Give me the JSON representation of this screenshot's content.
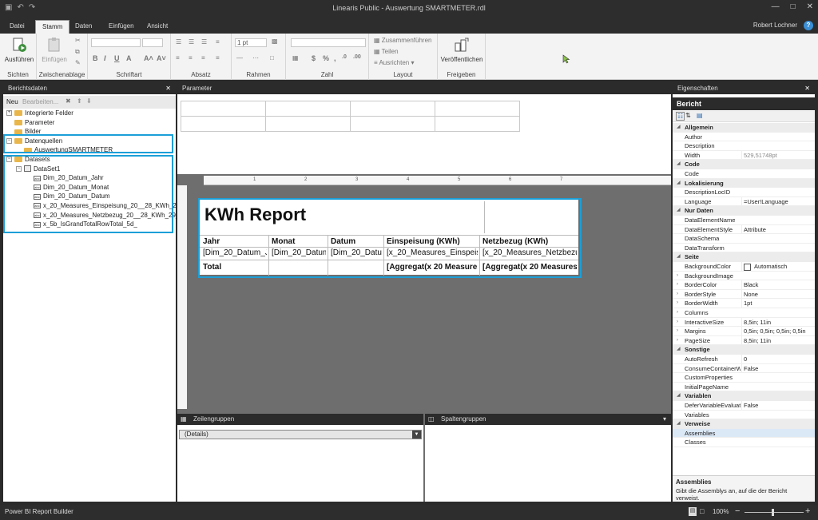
{
  "window": {
    "title": "Linearis Public - Auswertung SMARTMETER.rdl",
    "user": "Robert Lochner",
    "help": "?"
  },
  "tabs": [
    "Datei",
    "Stamm",
    "Daten",
    "Einfügen",
    "Ansicht"
  ],
  "ribbon": {
    "run": "Ausführen",
    "paste": "Einfügen",
    "groups": [
      "Sichten",
      "Zwischenablage",
      "Schriftart",
      "Absatz",
      "Rahmen",
      "Zahl",
      "Layout",
      "Freigeben"
    ],
    "border_width": "1 pt",
    "merge": "Zusammenführen",
    "split": "Teilen",
    "align": "Ausrichten",
    "publish": "Veröffentlichen",
    "font_btns": [
      "B",
      "I",
      "U",
      "A",
      "A˄",
      "A˅"
    ],
    "num_btns": [
      "$",
      "%",
      ",",
      ".0",
      ".00"
    ]
  },
  "left": {
    "header": "Berichtsdaten",
    "new": "Neu",
    "edit": "Bearbeiten...",
    "tree": [
      {
        "label": "Integrierte Felder",
        "indent": 0,
        "type": "folder",
        "exp": "+"
      },
      {
        "label": "Parameter",
        "indent": 0,
        "type": "folder",
        "exp": ""
      },
      {
        "label": "Bilder",
        "indent": 0,
        "type": "folder",
        "exp": ""
      },
      {
        "label": "Datenquellen",
        "indent": 0,
        "type": "folder",
        "exp": "−"
      },
      {
        "label": "AuswertungSMARTMETER",
        "indent": 1,
        "type": "folder",
        "exp": ""
      },
      {
        "label": "Datasets",
        "indent": 0,
        "type": "folder",
        "exp": "−"
      },
      {
        "label": "DataSet1",
        "indent": 1,
        "type": "dataset",
        "exp": "−"
      },
      {
        "label": "Dim_20_Datum_Jahr",
        "indent": 2,
        "type": "field",
        "exp": ""
      },
      {
        "label": "Dim_20_Datum_Monat",
        "indent": 2,
        "type": "field",
        "exp": ""
      },
      {
        "label": "Dim_20_Datum_Datum",
        "indent": 2,
        "type": "field",
        "exp": ""
      },
      {
        "label": "x_20_Measures_Einspeisung_20__28_KWh_29_",
        "indent": 2,
        "type": "field",
        "exp": ""
      },
      {
        "label": "x_20_Measures_Netzbezug_20__28_KWh_29_",
        "indent": 2,
        "type": "field",
        "exp": ""
      },
      {
        "label": "x_5b_IsGrandTotalRowTotal_5d_",
        "indent": 2,
        "type": "field",
        "exp": ""
      }
    ],
    "field_icon": "abc"
  },
  "center": {
    "param_header": "Parameter",
    "ruler": [
      "1",
      "2",
      "3",
      "4",
      "5",
      "6",
      "7"
    ],
    "report": {
      "title": "KWh Report",
      "headers": [
        "Jahr",
        "Monat",
        "Datum",
        "Einspeisung (KWh)",
        "Netzbezug (KWh)"
      ],
      "details": [
        "[Dim_20_Datum_Jahr",
        "[Dim_20_Datum_",
        "[Dim_20_Datum",
        "[x_20_Measures_Einspeisung",
        "[x_20_Measures_Netzbezug_"
      ],
      "total": [
        "Total",
        "",
        "",
        "[Aggregat(x 20 Measures",
        "[Aggregat(x 20 Measures"
      ]
    },
    "rowgroups": {
      "header": "Zeilengruppen",
      "item": "(Details)"
    },
    "colgroups": {
      "header": "Spaltengruppen"
    }
  },
  "properties": {
    "header": "Eigenschaften",
    "object": "Bericht",
    "rows": [
      {
        "cat": "Allgemein"
      },
      {
        "n": "Author",
        "v": ""
      },
      {
        "n": "Description",
        "v": ""
      },
      {
        "n": "Width",
        "v": "529,51748pt",
        "dim": true
      },
      {
        "cat": "Code"
      },
      {
        "n": "Code",
        "v": ""
      },
      {
        "cat": "Lokalisierung"
      },
      {
        "n": "DescriptionLocID",
        "v": ""
      },
      {
        "n": "Language",
        "v": "=User!Language"
      },
      {
        "cat": "Nur Daten"
      },
      {
        "n": "DataElementName",
        "v": ""
      },
      {
        "n": "DataElementStyle",
        "v": "Attribute"
      },
      {
        "n": "DataSchema",
        "v": ""
      },
      {
        "n": "DataTransform",
        "v": ""
      },
      {
        "cat": "Seite"
      },
      {
        "n": "BackgroundColor",
        "v": "Automatisch",
        "swatch": true
      },
      {
        "n": "BackgroundImage",
        "v": "",
        "arr": true
      },
      {
        "n": "BorderColor",
        "v": "Black",
        "arr": true
      },
      {
        "n": "BorderStyle",
        "v": "None",
        "arr": true
      },
      {
        "n": "BorderWidth",
        "v": "1pt",
        "arr": true
      },
      {
        "n": "Columns",
        "v": "",
        "arr": true
      },
      {
        "n": "InteractiveSize",
        "v": "8,5in; 11in",
        "arr": true
      },
      {
        "n": "Margins",
        "v": "0,5in; 0,5in; 0,5in; 0,5in",
        "arr": true
      },
      {
        "n": "PageSize",
        "v": "8,5in; 11in",
        "arr": true
      },
      {
        "cat": "Sonstige"
      },
      {
        "n": "AutoRefresh",
        "v": "0"
      },
      {
        "n": "ConsumeContainerWhitespace",
        "v": "False"
      },
      {
        "n": "CustomProperties",
        "v": ""
      },
      {
        "n": "InitialPageName",
        "v": ""
      },
      {
        "cat": "Variablen"
      },
      {
        "n": "DeferVariableEvaluation",
        "v": "False"
      },
      {
        "n": "Variables",
        "v": ""
      },
      {
        "cat": "Verweise"
      },
      {
        "n": "Assemblies",
        "v": "",
        "sel": true
      },
      {
        "n": "Classes",
        "v": ""
      }
    ],
    "help_title": "Assemblies",
    "help_text": "Gibt die Assemblys an, auf die der Bericht verweist."
  },
  "status": {
    "app": "Power BI Report Builder",
    "zoom": "100%"
  },
  "colors": {
    "accent": "#1b9fd8",
    "chrome": "#2d2d2d"
  }
}
